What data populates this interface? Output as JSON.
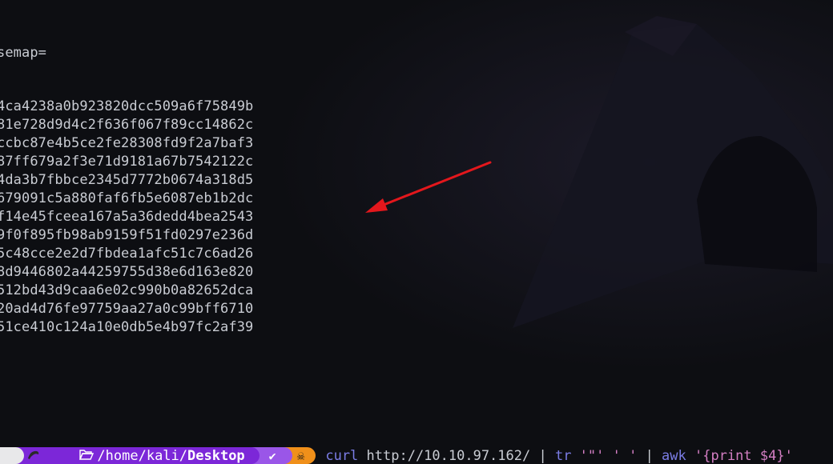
{
  "terminal": {
    "header_line": "semap=",
    "hashes": [
      "4ca4238a0b923820dcc509a6f75849b",
      "81e728d9d4c2f636f067f89cc14862c",
      "ccbc87e4b5ce2fe28308fd9f2a7baf3",
      "87ff679a2f3e71d9181a67b7542122c",
      "4da3b7fbbce2345d7772b0674a318d5",
      "679091c5a880faf6fb5e6087eb1b2dc",
      "f14e45fceea167a5a36dedd4bea2543",
      "9f0f895fb98ab9159f51fd0297e236d",
      "5c48cce2e2d7fbdea1afc51c7c6ad26",
      "8d9446802a44259755d38e6d163e820",
      "512bd43d9caa6e02c990b0a82652dca",
      "20ad4d76fe97759aa27a0c99bff6710",
      "51ce410c124a10e0db5e4b97fc2af39"
    ]
  },
  "prompt": {
    "os_icon": "kali-icon",
    "folder_icon": "folder-open-icon",
    "path_prefix": "/home/kali/",
    "path_current": "Desktop",
    "status_icon": "✔",
    "user_icon": "☠",
    "command": {
      "cmd1": "curl",
      "arg1": " http://10.10.97.162/ ",
      "pipe1": "| ",
      "cmd2": "tr",
      "str1": " '\"' ' ' ",
      "pipe2": "| ",
      "cmd3": "awk",
      "str2": " '{print $4}'"
    }
  },
  "colors": {
    "background": "#0d0e12",
    "text": "#c9ccd3",
    "prompt_dir": "#7c27d8",
    "prompt_status": "#9a56e8",
    "prompt_user": "#f0901a",
    "command": "#7b7de6",
    "string": "#d47fc4",
    "annotation_arrow": "#e3171c"
  }
}
